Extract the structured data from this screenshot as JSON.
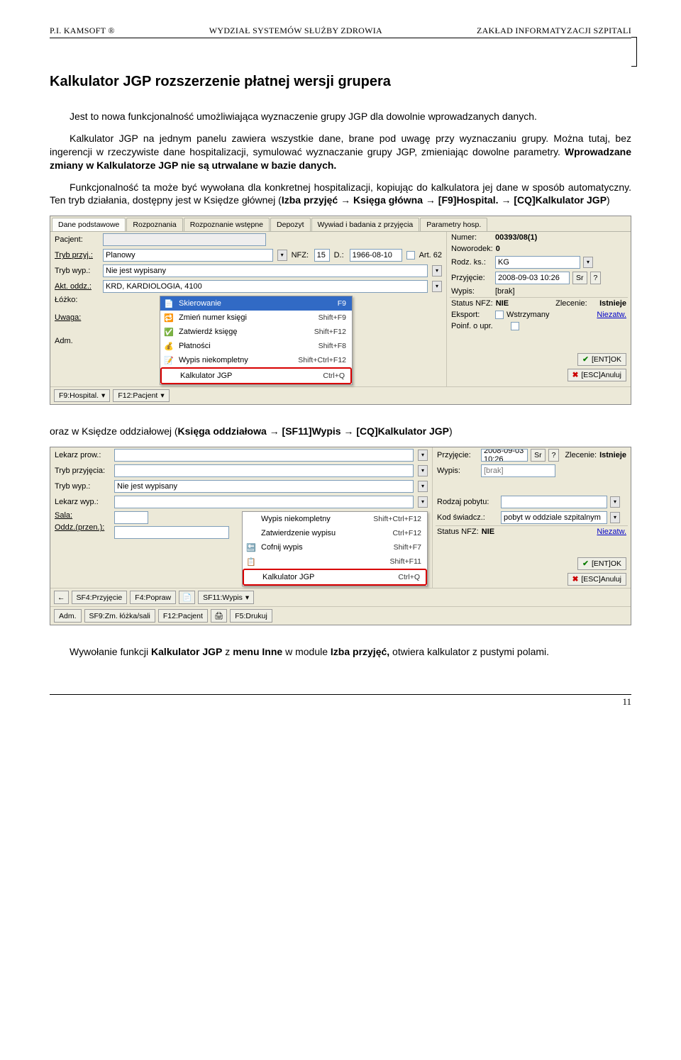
{
  "header": {
    "left": "P.I. KAMSOFT ®",
    "center": "WYDZIAŁ SYSTEMÓW SŁUŻBY ZDROWIA",
    "right": "ZAKŁAD INFORMATYZACJI SZPITALI"
  },
  "title": "Kalkulator JGP rozszerzenie płatnej wersji grupera",
  "para1": "Jest to nowa funkcjonalność umożliwiająca wyznaczenie grupy JGP dla dowolnie wprowadzanych danych.",
  "para2a": "Kalkulator JGP na jednym panelu zawiera wszystkie dane, brane pod uwagę przy wyznaczaniu grupy. Można tutaj, bez ingerencji w rzeczywiste dane hospitalizacji, symulować wyznaczanie grupy JGP, zmieniając dowolne parametry. ",
  "para2b": "Wprowadzane zmiany w Kalkulatorze JGP nie są utrwalane w bazie danych.",
  "para3a": "Funkcjonalność ta może być wywołana dla konkretnej hospitalizacji, kopiując do kalkulatora jej dane w sposób automatyczny. Ten tryb działania, dostępny jest w Księdze głównej (",
  "para3b": "Izba przyjęć → Księga główna → [F9]Hospital. → [CQ]Kalkulator JGP",
  "para3c": ")",
  "between_shots_a": "oraz w Księdze oddziałowej (",
  "between_shots_b": "Księga oddziałowa → [SF11]Wypis → [CQ]Kalkulator JGP",
  "between_shots_c": ")",
  "para_end_a": "Wywołanie funkcji ",
  "para_end_b": "Kalkulator JGP",
  "para_end_c": " z ",
  "para_end_d": "menu Inne",
  "para_end_e": " w module ",
  "para_end_f": "Izba przyjęć,",
  "para_end_g": " otwiera kalkulator z pustymi polami.",
  "shot1": {
    "tabs": [
      "Dane podstawowe",
      "Rozpoznania",
      "Rozpoznanie wstępne",
      "Depozyt",
      "Wywiad i badania z przyjęcia",
      "Parametry hosp."
    ],
    "rows": {
      "pacjent": "Pacjent:",
      "pacjent_val": "",
      "numer_l": "Numer:",
      "numer_v": "00393/08(1)",
      "tryb_przy": "Tryb przyj.:",
      "tryb_przy_v": "Planowy",
      "nfz_l": "NFZ:",
      "nfz_v": "15",
      "d_l": "D.:",
      "d_v": "1966-08-10",
      "art62": "Art. 62",
      "nowor_l": "Noworodek:",
      "nowor_v": "0",
      "tryb_wyp": "Tryb wyp.:",
      "tryb_wyp_v": "Nie jest wypisany",
      "rodzk_l": "Rodz. ks.:",
      "rodzk_v": "KG",
      "akt_odd_l": "Akt. oddz.:",
      "akt_odd_v": "KRD, KARDIOLOGIA, 4100",
      "przyj_l": "Przyjęcie:",
      "przyj_v": "2008-09-03 10:26",
      "lozko": "Łóżko:",
      "uwaga": "Uwaga:",
      "adm": "Adm.",
      "wypis_l": "Wypis:",
      "wypis_v": "[brak]",
      "status_l": "Status NFZ:",
      "status_v": "NIE",
      "zlec_l": "Zlecenie:",
      "zlec_v": "Istnieje",
      "eksp_l": "Eksport:",
      "wstrz": "Wstrzymany",
      "niezatw": "Niezatw.",
      "poinf": "Poinf. o upr."
    },
    "menu": [
      {
        "ic": "📄",
        "txt": "Skierowanie",
        "sc": "F9",
        "hl": true
      },
      {
        "ic": "🔁",
        "txt": "Zmień numer księgi",
        "sc": "Shift+F9"
      },
      {
        "ic": "✅",
        "txt": "Zatwierdź księgę",
        "sc": "Shift+F12"
      },
      {
        "ic": "💰",
        "txt": "Płatności",
        "sc": "Shift+F8"
      },
      {
        "ic": "📝",
        "txt": "Wypis niekompletny",
        "sc": "Shift+Ctrl+F12"
      },
      {
        "ic": "",
        "txt": "Kalkulator JGP",
        "sc": "Ctrl+Q",
        "boxed": true
      }
    ],
    "bottom": {
      "b1": "F9:Hospital.",
      "b2": "F12:Pacjent",
      "ok": "[ENT]OK",
      "cancel": "[ESC]Anuluj"
    },
    "btn_sr": "Sr"
  },
  "shot2": {
    "rows": {
      "lekarz": "Lekarz prow.:",
      "tryb_prz": "Tryb przyjęcia:",
      "tryb_wyp": "Tryb wyp.:",
      "tryb_wyp_v": "Nie jest wypisany",
      "lek_wyp": "Lekarz wyp.:",
      "sala": "Sala:",
      "oddz": "Oddz.(przen.):",
      "przyj_l": "Przyjęcie:",
      "przyj_v": "2008-09-03 10:26",
      "wypis_l": "Wypis:",
      "wypis_v": "[brak]",
      "rodzp_l": "Rodzaj pobytu:",
      "kodsw_l": "Kod świadcz.:",
      "kodsw_v": "pobyt w oddziale szpitalnym",
      "status_l": "Status NFZ:",
      "status_v": "NIE",
      "zlec_l": "Zlecenie:",
      "zlec_v": "Istnieje",
      "niezatw": "Niezatw."
    },
    "menu": [
      {
        "ic": "",
        "txt": "Wypis niekompletny",
        "sc": "Shift+Ctrl+F12"
      },
      {
        "ic": "",
        "txt": "Zatwierdzenie wypisu",
        "sc": "Ctrl+F12"
      },
      {
        "ic": "🔙",
        "txt": "Cofnij wypis",
        "sc": "Shift+F7"
      },
      {
        "ic": "📋",
        "txt": "",
        "sc": "Shift+F11"
      },
      {
        "ic": "",
        "txt": "Kalkulator JGP",
        "sc": "Ctrl+Q",
        "boxed": true
      }
    ],
    "bottom": {
      "b1": "SF4:Przyjęcie",
      "b2": "F4:Popraw",
      "b3": "SF11:Wypis",
      "c1": "Adm.",
      "c2": "SF9:Zm. łóżka/sali",
      "c3": "F12:Pacjent",
      "c4": "F5:Drukuj",
      "ok": "[ENT]OK",
      "cancel": "[ESC]Anuluj"
    },
    "btn_sr": "Sr"
  },
  "page": "11"
}
